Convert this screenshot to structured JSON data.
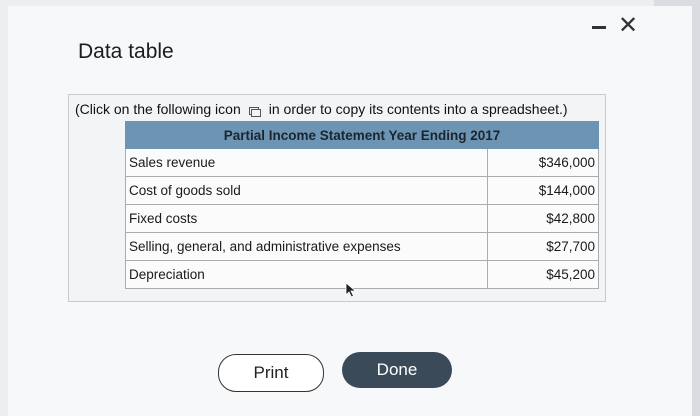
{
  "window": {
    "title": "Data table"
  },
  "instruction": {
    "before": "(Click on the following icon",
    "after": "in order to copy its contents into a spreadsheet.)",
    "icon": "copy-icon"
  },
  "table": {
    "header": "Partial Income Statement Year Ending 2017",
    "rows": [
      {
        "label": "Sales revenue",
        "value": "$346,000"
      },
      {
        "label": "Cost of goods sold",
        "value": "$144,000"
      },
      {
        "label": "Fixed costs",
        "value": "$42,800"
      },
      {
        "label": "Selling, general, and administrative expenses",
        "value": "$27,700"
      },
      {
        "label": "Depreciation",
        "value": "$45,200"
      }
    ]
  },
  "buttons": {
    "print": "Print",
    "done": "Done"
  },
  "colors": {
    "table_header": "#6d95b3",
    "done_button": "#3b4a58"
  }
}
